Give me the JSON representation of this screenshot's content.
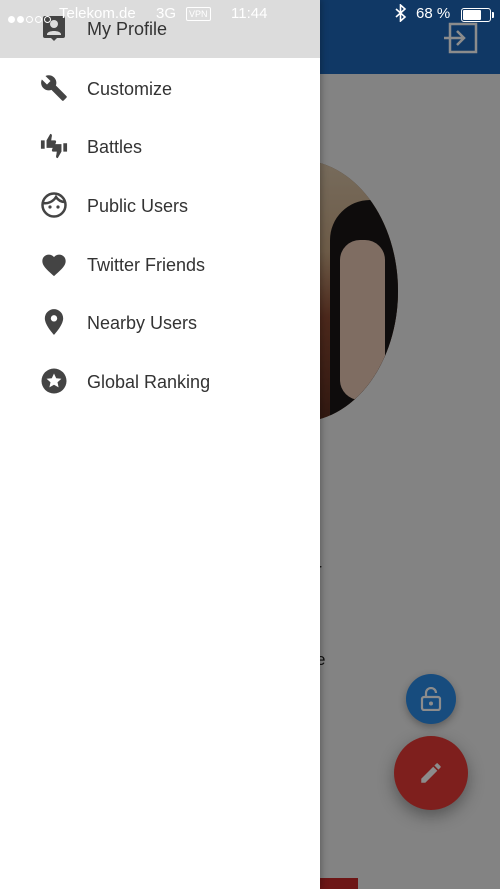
{
  "status_bar": {
    "carrier": "Telekom.de",
    "network": "3G",
    "vpn": "VPN",
    "time": "11:44",
    "battery_percent": "68 %",
    "battery_level": 0.68
  },
  "colors": {
    "toolbar": "#1e66b8",
    "fab_lock": "#2b8ae6",
    "fab_edit": "#e53935",
    "drawer_active": "#dcdcdc",
    "icon": "#444444"
  },
  "background": {
    "partial_text_1": "r",
    "partial_text_2": "e"
  },
  "drawer": {
    "items": [
      {
        "label": "My Profile",
        "icon": "account-box-icon",
        "active": true
      },
      {
        "label": "Customize",
        "icon": "wrench-icon",
        "active": false
      },
      {
        "label": "Battles",
        "icon": "thumbs-up-down-icon",
        "active": false
      },
      {
        "label": "Public Users",
        "icon": "face-icon",
        "active": false
      },
      {
        "label": "Twitter Friends",
        "icon": "heart-icon",
        "active": false
      },
      {
        "label": "Nearby Users",
        "icon": "location-pin-icon",
        "active": false
      },
      {
        "label": "Global Ranking",
        "icon": "star-circle-icon",
        "active": false
      }
    ]
  }
}
